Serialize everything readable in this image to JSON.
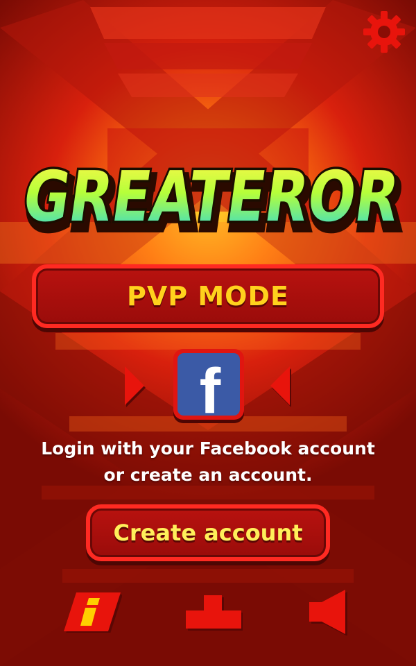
{
  "game": {
    "title": "GREATEROR",
    "pvp_label": "PVP MODE",
    "login_line1": "Login with your Facebook account",
    "login_line2": "or create an account.",
    "create_label": "Create account",
    "facebook_glyph": "f"
  },
  "icons": {
    "settings": "gear-icon",
    "prev": "triangle-right-icon",
    "next": "triangle-left-icon",
    "facebook": "facebook-icon",
    "info": "info-icon",
    "leaderboard": "podium-icon",
    "sound": "speaker-icon"
  },
  "colors": {
    "background": "#8a0d05",
    "accent_red": "#ff2a22",
    "button_text_gold": "#ffd21d",
    "facebook_blue": "#3b5aa6",
    "info_yellow": "#ffd000"
  }
}
